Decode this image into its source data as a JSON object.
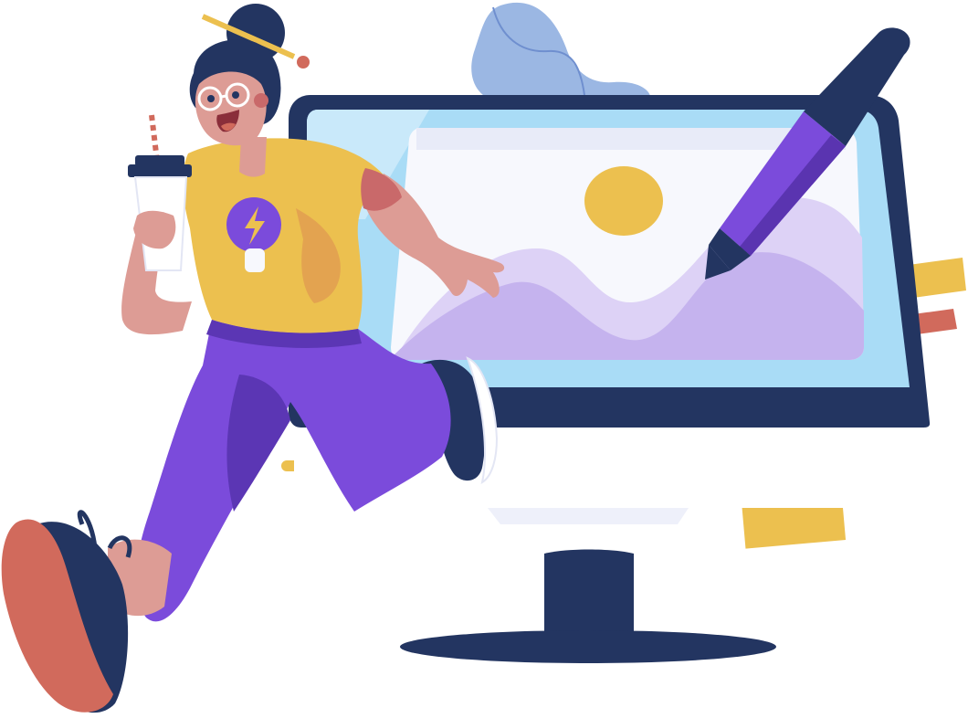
{
  "illustration": {
    "subject": "",
    "palette": {
      "navy": "#233561",
      "purple": "#7b4bdb",
      "light_purple": "#c5b3ee",
      "pale_purple": "#ddd2f6",
      "yellow": "#ecc04f",
      "sky_blue": "#a9dcf6",
      "cloud_blue": "#9bb7e3",
      "skin": "#dd9c95",
      "skin_shadow": "#c9696a",
      "coral": "#d16a5c",
      "screen_white": "#f7f8fd"
    },
    "icons": [
      "lightning-bolt-icon",
      "image-placeholder-icon",
      "stylus-pen-icon"
    ]
  }
}
